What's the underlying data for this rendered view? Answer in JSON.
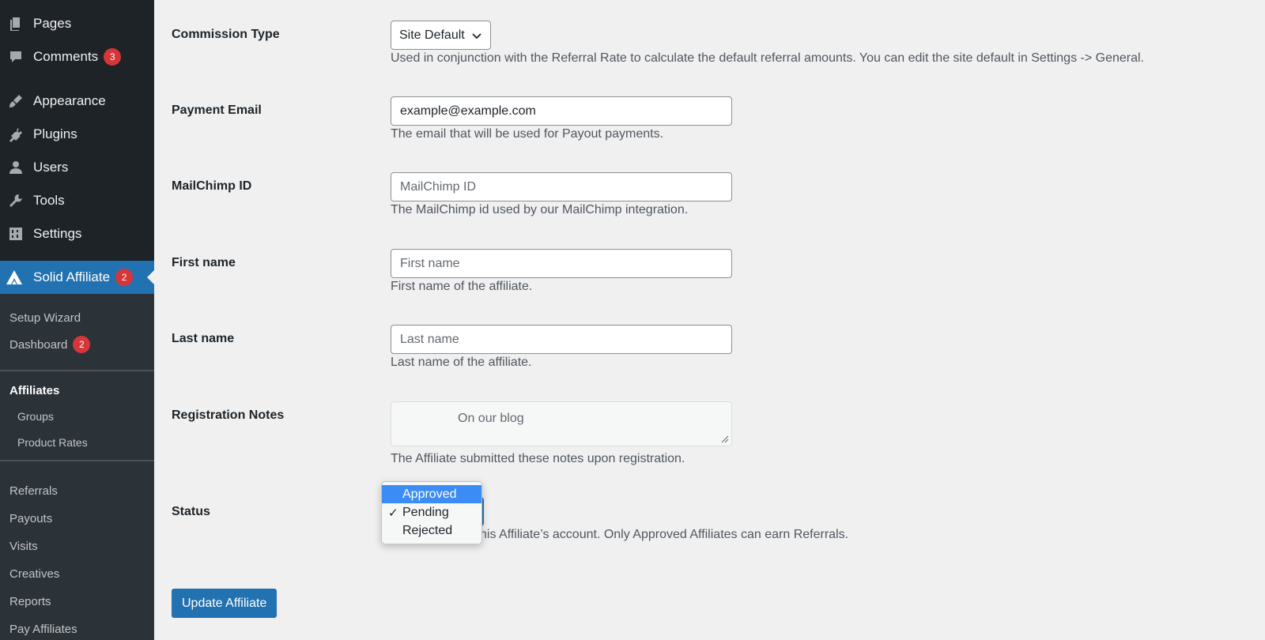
{
  "sidebar": {
    "top_items": [
      {
        "label": "Pages",
        "icon": "pages-icon"
      },
      {
        "label": "Comments",
        "icon": "comments-icon",
        "badge": "3"
      },
      {
        "label": "Appearance",
        "icon": "appearance-icon"
      },
      {
        "label": "Plugins",
        "icon": "plugins-icon"
      },
      {
        "label": "Users",
        "icon": "users-icon"
      },
      {
        "label": "Tools",
        "icon": "tools-icon"
      },
      {
        "label": "Settings",
        "icon": "settings-icon"
      }
    ],
    "active": {
      "label": "Solid Affiliate",
      "badge": "2",
      "icon": "solid-affiliate-icon"
    },
    "submenu": {
      "setup_wizard": "Setup Wizard",
      "dashboard": "Dashboard",
      "dashboard_badge": "2",
      "affiliates": "Affiliates",
      "groups": "Groups",
      "product_rates": "Product Rates",
      "referrals": "Referrals",
      "payouts": "Payouts",
      "visits": "Visits",
      "creatives": "Creatives",
      "reports": "Reports",
      "pay_affiliates": "Pay Affiliates"
    }
  },
  "form": {
    "commission_type": {
      "label": "Commission Type",
      "value": "Site Default",
      "desc": "Used in conjunction with the Referral Rate to calculate the default referral amounts. You can edit the site default in Settings -> General."
    },
    "payment_email": {
      "label": "Payment Email",
      "value": "example@example.com",
      "desc": "The email that will be used for Payout payments."
    },
    "mailchimp_id": {
      "label": "MailChimp ID",
      "placeholder": "MailChimp ID",
      "desc": "The MailChimp id used by our MailChimp integration."
    },
    "first_name": {
      "label": "First name",
      "placeholder": "First name",
      "desc": "First name of the affiliate."
    },
    "last_name": {
      "label": "Last name",
      "placeholder": "Last name",
      "desc": "Last name of the affiliate."
    },
    "registration_notes": {
      "label": "Registration Notes",
      "value": "On our blog",
      "desc": "The Affiliate submitted these notes upon registration."
    },
    "status": {
      "label": "Status",
      "options": [
        "Approved",
        "Pending",
        "Rejected"
      ],
      "selected": "Pending",
      "highlighted": "Approved",
      "checkmark": "✓",
      "desc_visible": "his Affiliate’s account. Only Approved Affiliates can earn Referrals."
    },
    "submit_label": "Update Affiliate"
  },
  "colors": {
    "sidebar_bg": "#2c3338",
    "sidebar_top_bg": "#1d2327",
    "accent": "#2271b1",
    "badge": "#d63638",
    "dropdown_highlight": "#3b8cf5",
    "page_bg": "#f0f0f1"
  }
}
